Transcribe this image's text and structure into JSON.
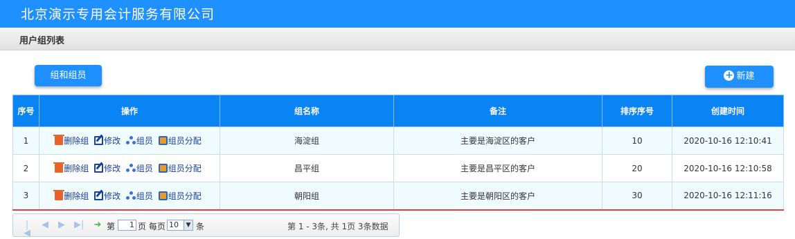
{
  "app": {
    "title": "北京演示专用会计服务有限公司"
  },
  "breadcrumb": {
    "label": "用户组列表"
  },
  "toolbar": {
    "group_button": "组和组员",
    "new_button": "新建",
    "new_icon": "plus-circle-icon"
  },
  "table": {
    "columns": [
      "序号",
      "操作",
      "组名称",
      "备注",
      "排序序号",
      "创建时间"
    ],
    "actions": {
      "delete": "删除组",
      "edit": "修改",
      "members": "组员",
      "assign": "组员分配"
    },
    "rows": [
      {
        "index": "1",
        "name": "海淀组",
        "remark": "主要是海淀区的客户",
        "sort": "10",
        "created": "2020-10-16 12:10:41"
      },
      {
        "index": "2",
        "name": "昌平组",
        "remark": "主要是昌平区的客户",
        "sort": "20",
        "created": "2020-10-16 12:10:58"
      },
      {
        "index": "3",
        "name": "朝阳组",
        "remark": "主要是朝阳区的客户",
        "sort": "30",
        "created": "2020-10-16 12:11:16"
      }
    ]
  },
  "pager": {
    "page_prefix": "第",
    "page_value": "1",
    "page_suffix": "页 每页",
    "page_size": "10",
    "size_suffix": "条",
    "info": "第 1 - 3条, 共 1页 3条数据"
  },
  "colors": {
    "header_blue": "#1e90ff",
    "table_header": "#0a84f5",
    "row_alt": "#effbfd",
    "link": "#1b3f9c"
  }
}
